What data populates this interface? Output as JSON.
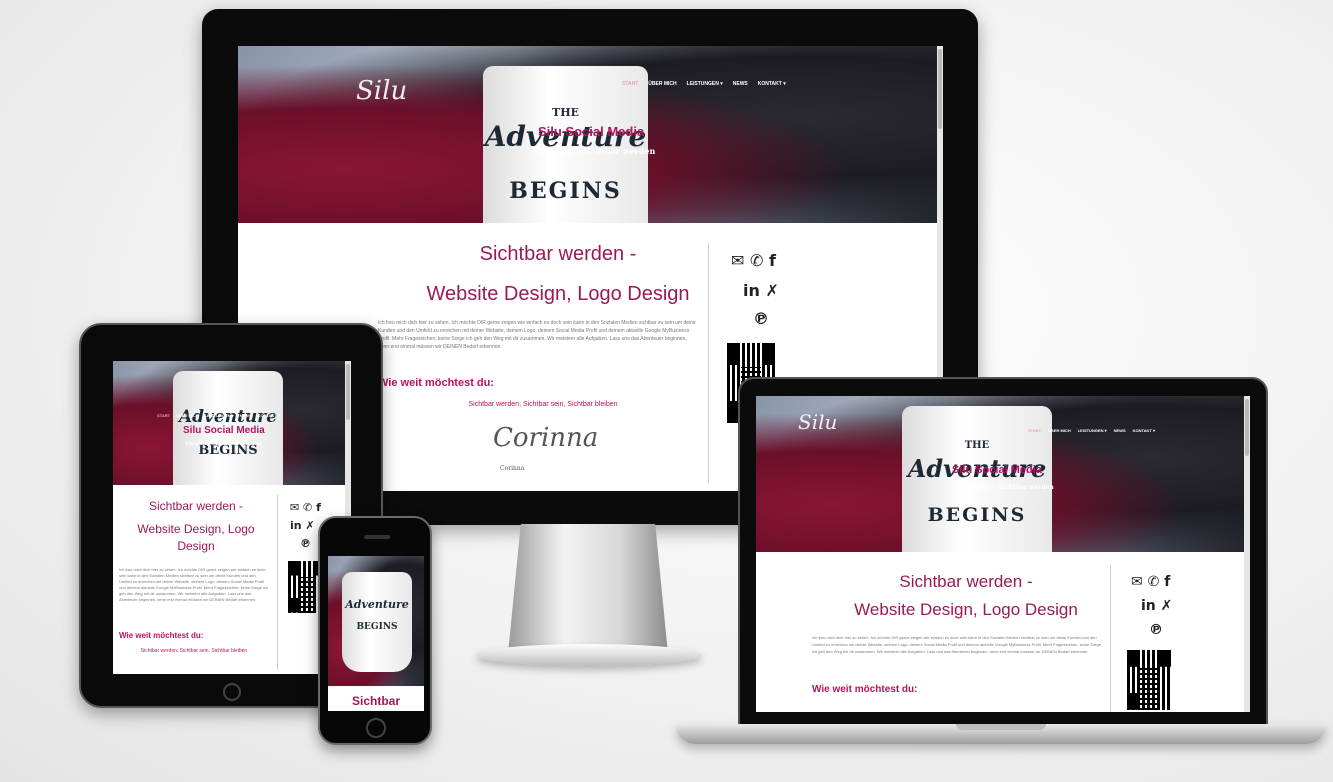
{
  "site": {
    "logo": "Silu",
    "logo_tagline": "Social Media",
    "nav": [
      "START",
      "ÜBER MICH",
      "LEISTUNGEN ▾",
      "NEWS",
      "KONTAKT ▾"
    ],
    "mug_small": "THE",
    "mug_big": "Adventure",
    "mug_bottom": "BEGINS",
    "hero_title": "Silu Social Media",
    "hero_subtitle": "Visibility - Sichtbar werden",
    "heading_line1": "Sichtbar werden -",
    "heading_line2": "Website Design, Logo Design",
    "intro": "Ich freu mich dich hier zu sehen. Ich möchte DIR gerne zeigen wie einfach es doch sein kann in den Sozialen Medien sichtbar zu sein um deine Kunden und den Umfeld zu erreichen mit deiner Website, deinem Logo, deinem Social Media Profil und deinem aktuelle Google MyBusiness Profil. Mehr Fragezeichen, keine Sorge ich geh den Weg mit dir zusammen. Wir meistern alle Aufgaben. Lass uns das Abenteuer beginnen, denn erst einmal müssen wir DEINEN Bedarf erkennen.",
    "question": "Wie weit möchtest du:",
    "options_line": "Sichtbar werden, Sichtbar sein, Sichtbar bleiben",
    "signature": "Corinna",
    "signature_name": "Corinna",
    "social_row1": "✉ ✆ f",
    "social_row2": "in ✗",
    "social_row3": "℗",
    "phone_heading": "Sichtbar"
  }
}
